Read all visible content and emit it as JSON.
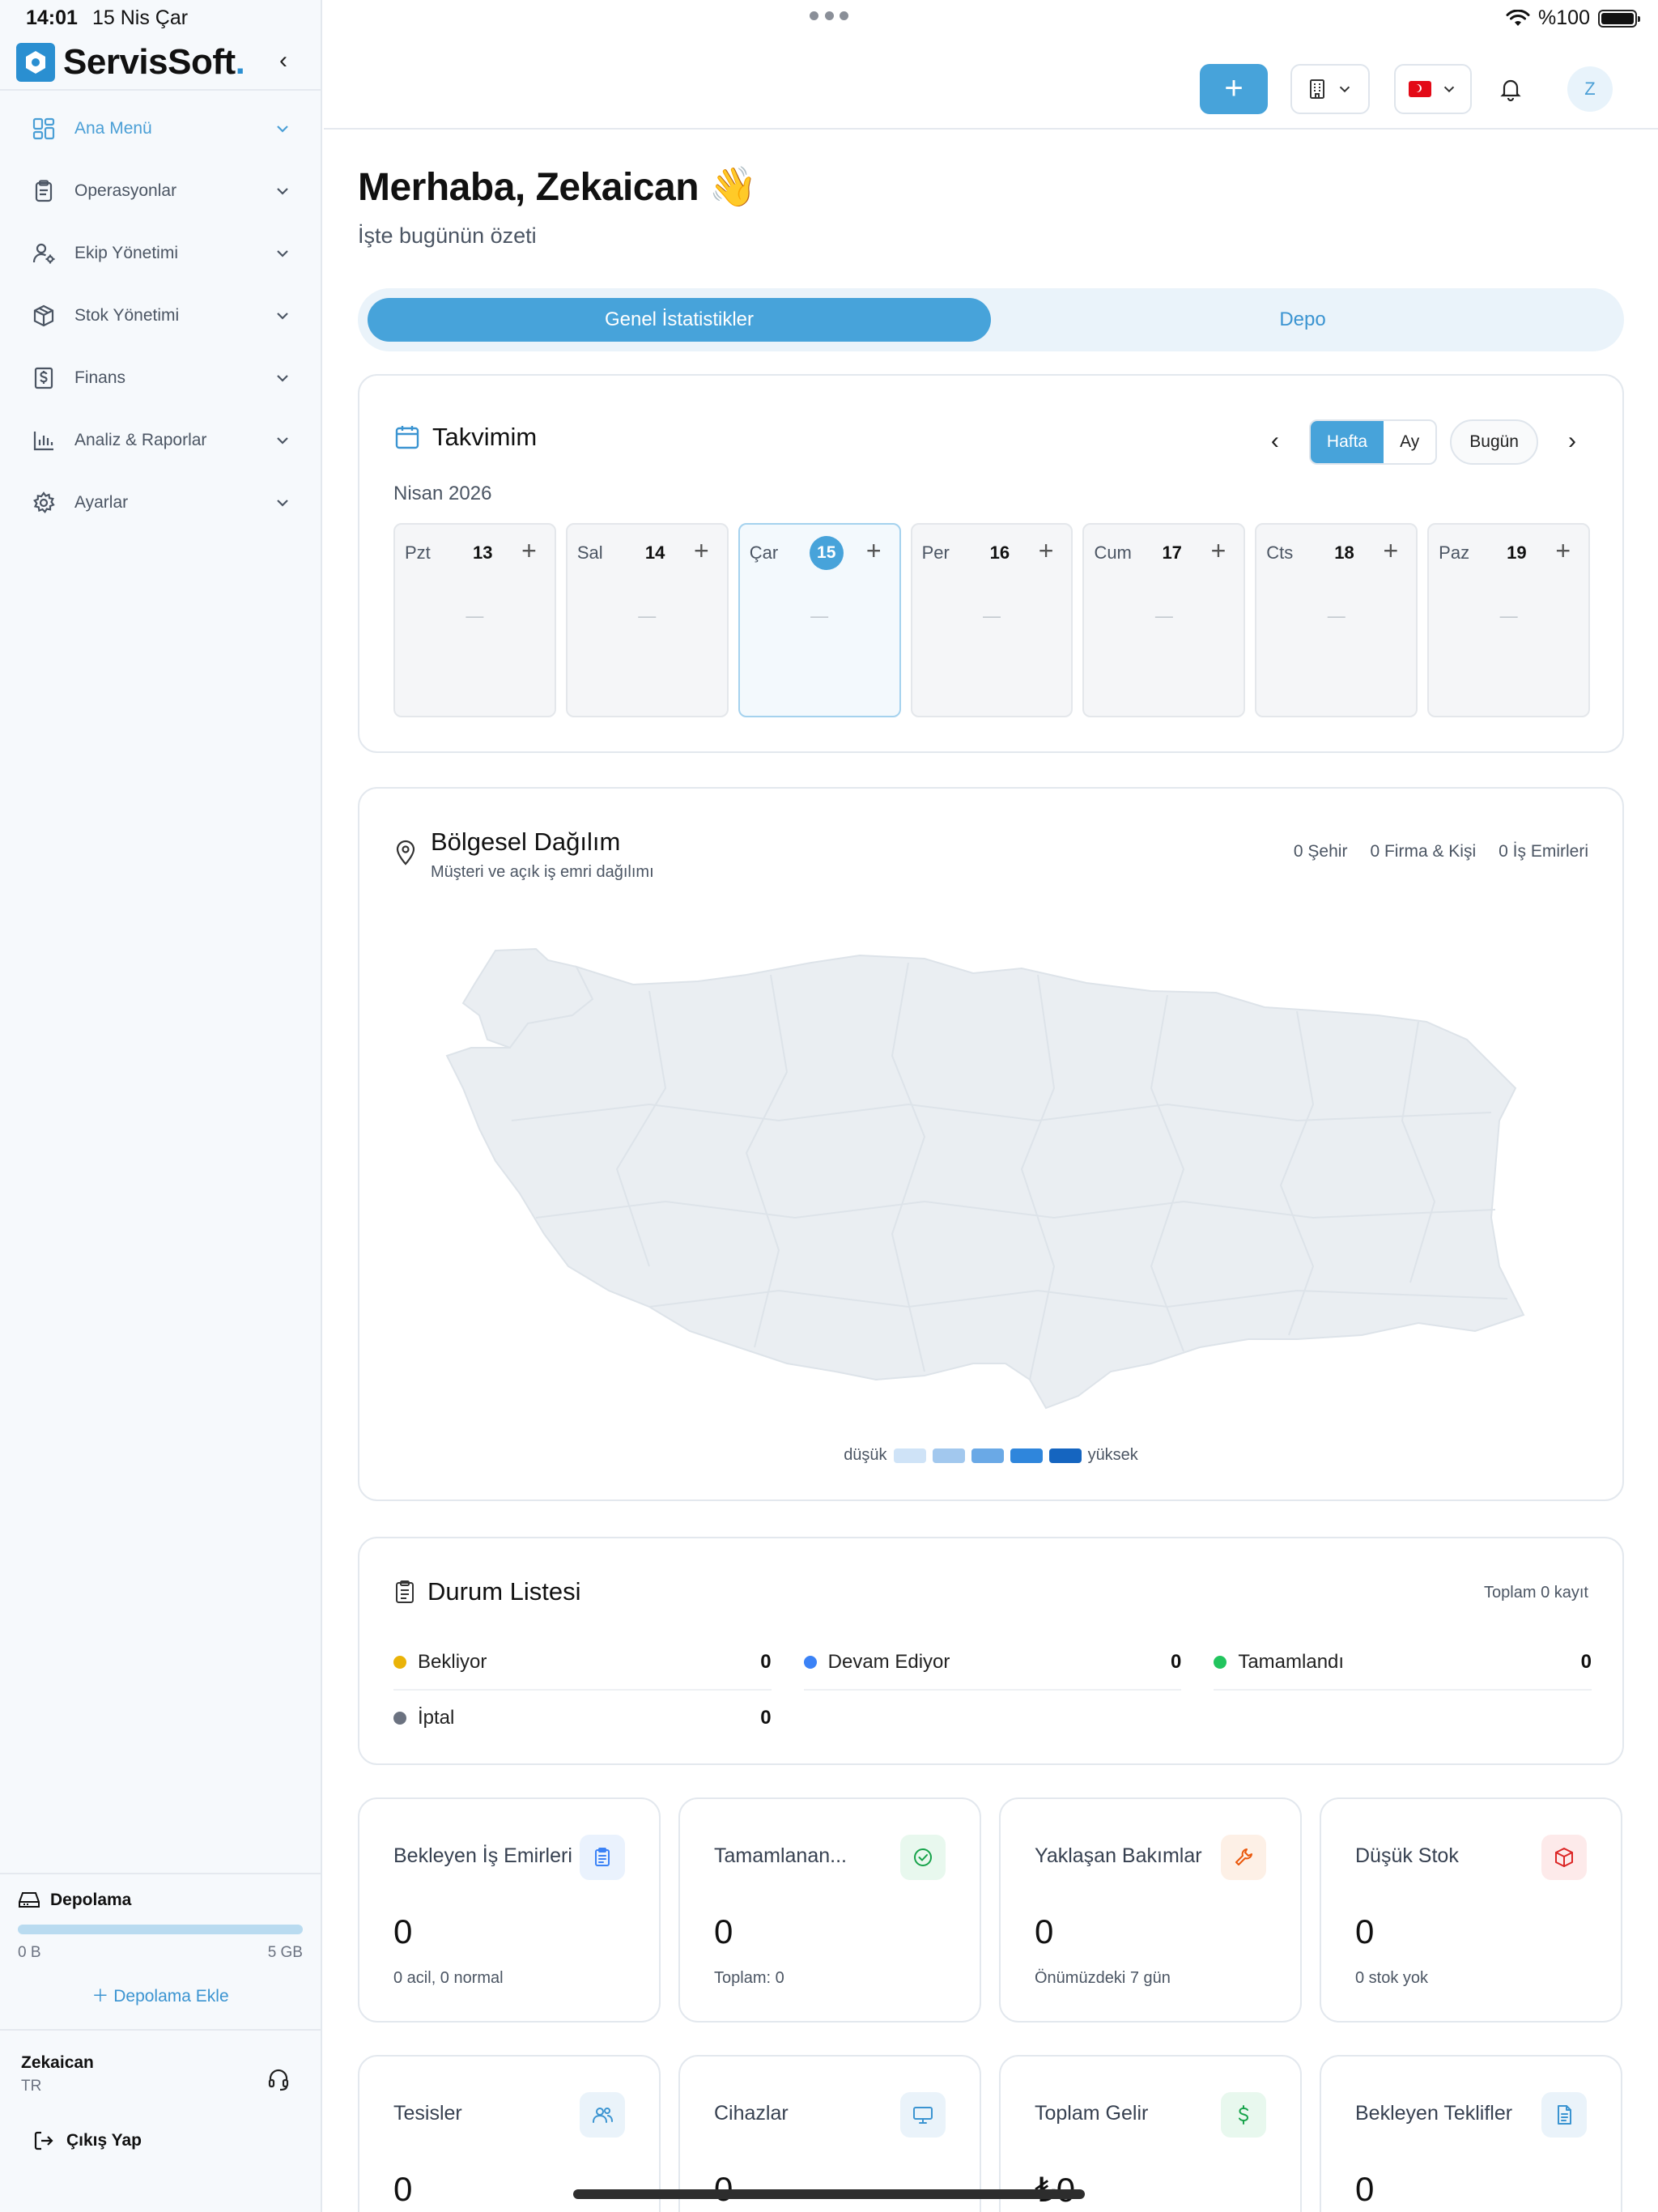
{
  "status_bar": {
    "time": "14:01",
    "date": "15 Nis Çar",
    "battery": "%100"
  },
  "sidebar": {
    "brand": "ServisSoft",
    "brand_dot": ".",
    "items": [
      {
        "label": "Ana Menü",
        "icon": "dashboard-icon",
        "active": true
      },
      {
        "label": "Operasyonlar",
        "icon": "clipboard-icon"
      },
      {
        "label": "Ekip Yönetimi",
        "icon": "user-settings-icon"
      },
      {
        "label": "Stok Yönetimi",
        "icon": "package-icon"
      },
      {
        "label": "Finans",
        "icon": "dollar-document-icon"
      },
      {
        "label": "Analiz & Raporlar",
        "icon": "bar-chart-icon"
      },
      {
        "label": "Ayarlar",
        "icon": "gear-icon"
      }
    ],
    "storage": {
      "title": "Depolama",
      "used": "0 B",
      "total": "5 GB",
      "used_fraction": 0,
      "add_label": "Depolama Ekle"
    },
    "user": {
      "name": "Zekaican",
      "lang": "TR"
    },
    "logout_label": "Çıkış Yap"
  },
  "topbar": {
    "add_label": "+",
    "avatar_initial": "Z"
  },
  "greeting": {
    "title": "Merhaba, Zekaican 👋",
    "subtitle": "İşte bugünün özeti"
  },
  "tabs": [
    {
      "label": "Genel İstatistikler",
      "active": true
    },
    {
      "label": "Depo",
      "active": false
    }
  ],
  "calendar": {
    "title": "Takvimim",
    "month": "Nisan 2026",
    "view_week": "Hafta",
    "view_month": "Ay",
    "today_label": "Bugün",
    "days": [
      {
        "name": "Pzt",
        "num": "13",
        "empty": "—"
      },
      {
        "name": "Sal",
        "num": "14",
        "empty": "—"
      },
      {
        "name": "Çar",
        "num": "15",
        "empty": "—",
        "today": true
      },
      {
        "name": "Per",
        "num": "16",
        "empty": "—"
      },
      {
        "name": "Cum",
        "num": "17",
        "empty": "—"
      },
      {
        "name": "Cts",
        "num": "18",
        "empty": "—"
      },
      {
        "name": "Paz",
        "num": "19",
        "empty": "—"
      }
    ]
  },
  "map": {
    "title": "Bölgesel Dağılım",
    "subtitle": "Müşteri ve açık iş emri dağılımı",
    "stats": [
      "0 Şehir",
      "0 Firma & Kişi",
      "0 İş Emirleri"
    ],
    "legend_low": "düşük",
    "legend_high": "yüksek",
    "legend_colors": [
      "#cfe3f7",
      "#a2c8ee",
      "#6aa9e6",
      "#2f86dc",
      "#1565c0"
    ],
    "fill_color": "#eaeef2"
  },
  "status_list": {
    "title": "Durum Listesi",
    "total": "Toplam 0 kayıt",
    "items": [
      {
        "name": "Bekliyor",
        "value": "0",
        "color": "#eab308"
      },
      {
        "name": "Devam Ediyor",
        "value": "0",
        "color": "#3b82f6"
      },
      {
        "name": "Tamamlandı",
        "value": "0",
        "color": "#22c55e"
      },
      {
        "name": "İptal",
        "value": "0",
        "color": "#6b7280"
      }
    ]
  },
  "kpis": [
    {
      "label": "Bekleyen İş Emirleri",
      "value": "0",
      "sub": "0 acil, 0 normal",
      "icon": "clipboard-list-icon",
      "color": "#3b82f6",
      "bg": "#eaf2fd"
    },
    {
      "label": "Tamamlanan...",
      "value": "0",
      "sub": "Toplam: 0",
      "icon": "check-circle-icon",
      "color": "#16a34a",
      "bg": "#e8f8ee"
    },
    {
      "label": "Yaklaşan Bakımlar",
      "value": "0",
      "sub": "Önümüzdeki 7 gün",
      "icon": "wrench-icon",
      "color": "#ea580c",
      "bg": "#fdf0e6"
    },
    {
      "label": "Düşük Stok",
      "value": "0",
      "sub": "0 stok yok",
      "icon": "package-alert-icon",
      "color": "#dc2626",
      "bg": "#fdeaea"
    },
    {
      "label": "Tesisler",
      "value": "0",
      "sub": "",
      "icon": "users-icon",
      "color": "#3b94d1",
      "bg": "#eaf3fa"
    },
    {
      "label": "Cihazlar",
      "value": "0",
      "sub": "",
      "icon": "monitor-icon",
      "color": "#3b94d1",
      "bg": "#eaf3fa"
    },
    {
      "label": "Toplam Gelir",
      "value": "₺0",
      "sub": "",
      "icon": "dollar-icon",
      "color": "#16a34a",
      "bg": "#e8f8ee"
    },
    {
      "label": "Bekleyen Teklifler",
      "value": "0",
      "sub": "",
      "icon": "document-icon",
      "color": "#3b94d1",
      "bg": "#eaf3fa"
    }
  ]
}
